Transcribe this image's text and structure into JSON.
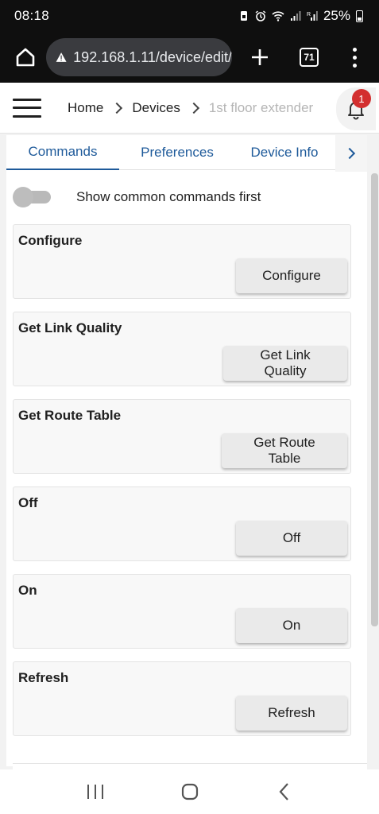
{
  "status_bar": {
    "time": "08:18",
    "battery_text": "25%",
    "icons": [
      "sim-icon",
      "alarm-icon",
      "wifi-icon",
      "signal-icon",
      "signal-r-icon",
      "battery-icon"
    ]
  },
  "browser": {
    "url": "192.168.1.11/device/edit/",
    "tab_count": "71",
    "icons": [
      "home-icon",
      "warning-icon",
      "plus-icon",
      "tabs-icon",
      "more-vert-icon"
    ]
  },
  "header": {
    "breadcrumb": [
      "Home",
      "Devices",
      "1st floor extender"
    ],
    "notification_count": "1",
    "icons": [
      "hamburger-icon",
      "chevron-right-icon",
      "bell-icon"
    ]
  },
  "tabs": [
    {
      "label": "Commands",
      "active": true
    },
    {
      "label": "Preferences",
      "active": false
    },
    {
      "label": "Device Info",
      "active": false
    }
  ],
  "toggle": {
    "label": "Show common commands first",
    "enabled": false
  },
  "commands": [
    {
      "title": "Configure",
      "button": "Configure"
    },
    {
      "title": "Get Link Quality",
      "button": "Get Link Quality"
    },
    {
      "title": "Get Route Table",
      "button": "Get Route Table"
    },
    {
      "title": "Off",
      "button": "Off"
    },
    {
      "title": "On",
      "button": "On"
    },
    {
      "title": "Refresh",
      "button": "Refresh"
    }
  ],
  "colors": {
    "accent": "#1e5a9a",
    "badge": "#d32f2f",
    "system_bar": "#0f0f0f"
  }
}
